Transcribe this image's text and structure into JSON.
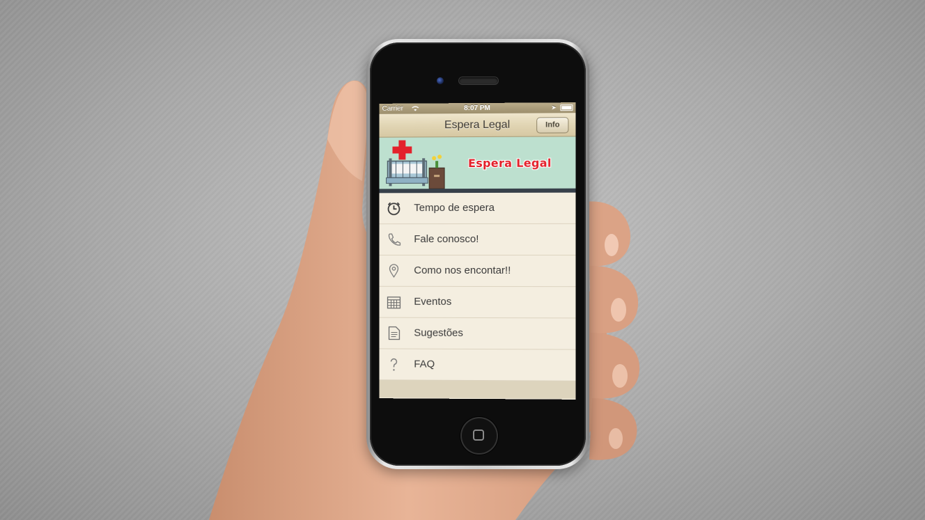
{
  "statusbar": {
    "carrier": "Carrier",
    "time": "8:07 PM"
  },
  "navbar": {
    "title": "Espera Legal",
    "info_label": "Info"
  },
  "banner": {
    "title": "Espera Legal"
  },
  "menu": {
    "items": [
      {
        "label": "Tempo de espera",
        "icon": "alarm-clock-icon"
      },
      {
        "label": "Fale conosco!",
        "icon": "phone-icon"
      },
      {
        "label": "Como nos encontar!!",
        "icon": "map-pin-icon"
      },
      {
        "label": "Eventos",
        "icon": "calendar-icon"
      },
      {
        "label": "Sugestões",
        "icon": "document-icon"
      },
      {
        "label": "FAQ",
        "icon": "question-icon"
      }
    ]
  },
  "colors": {
    "navbar": "#e1d5b4",
    "menu_background": "#f4eee0",
    "banner_background": "#bde0cf",
    "banner_title": "#e3212b"
  }
}
